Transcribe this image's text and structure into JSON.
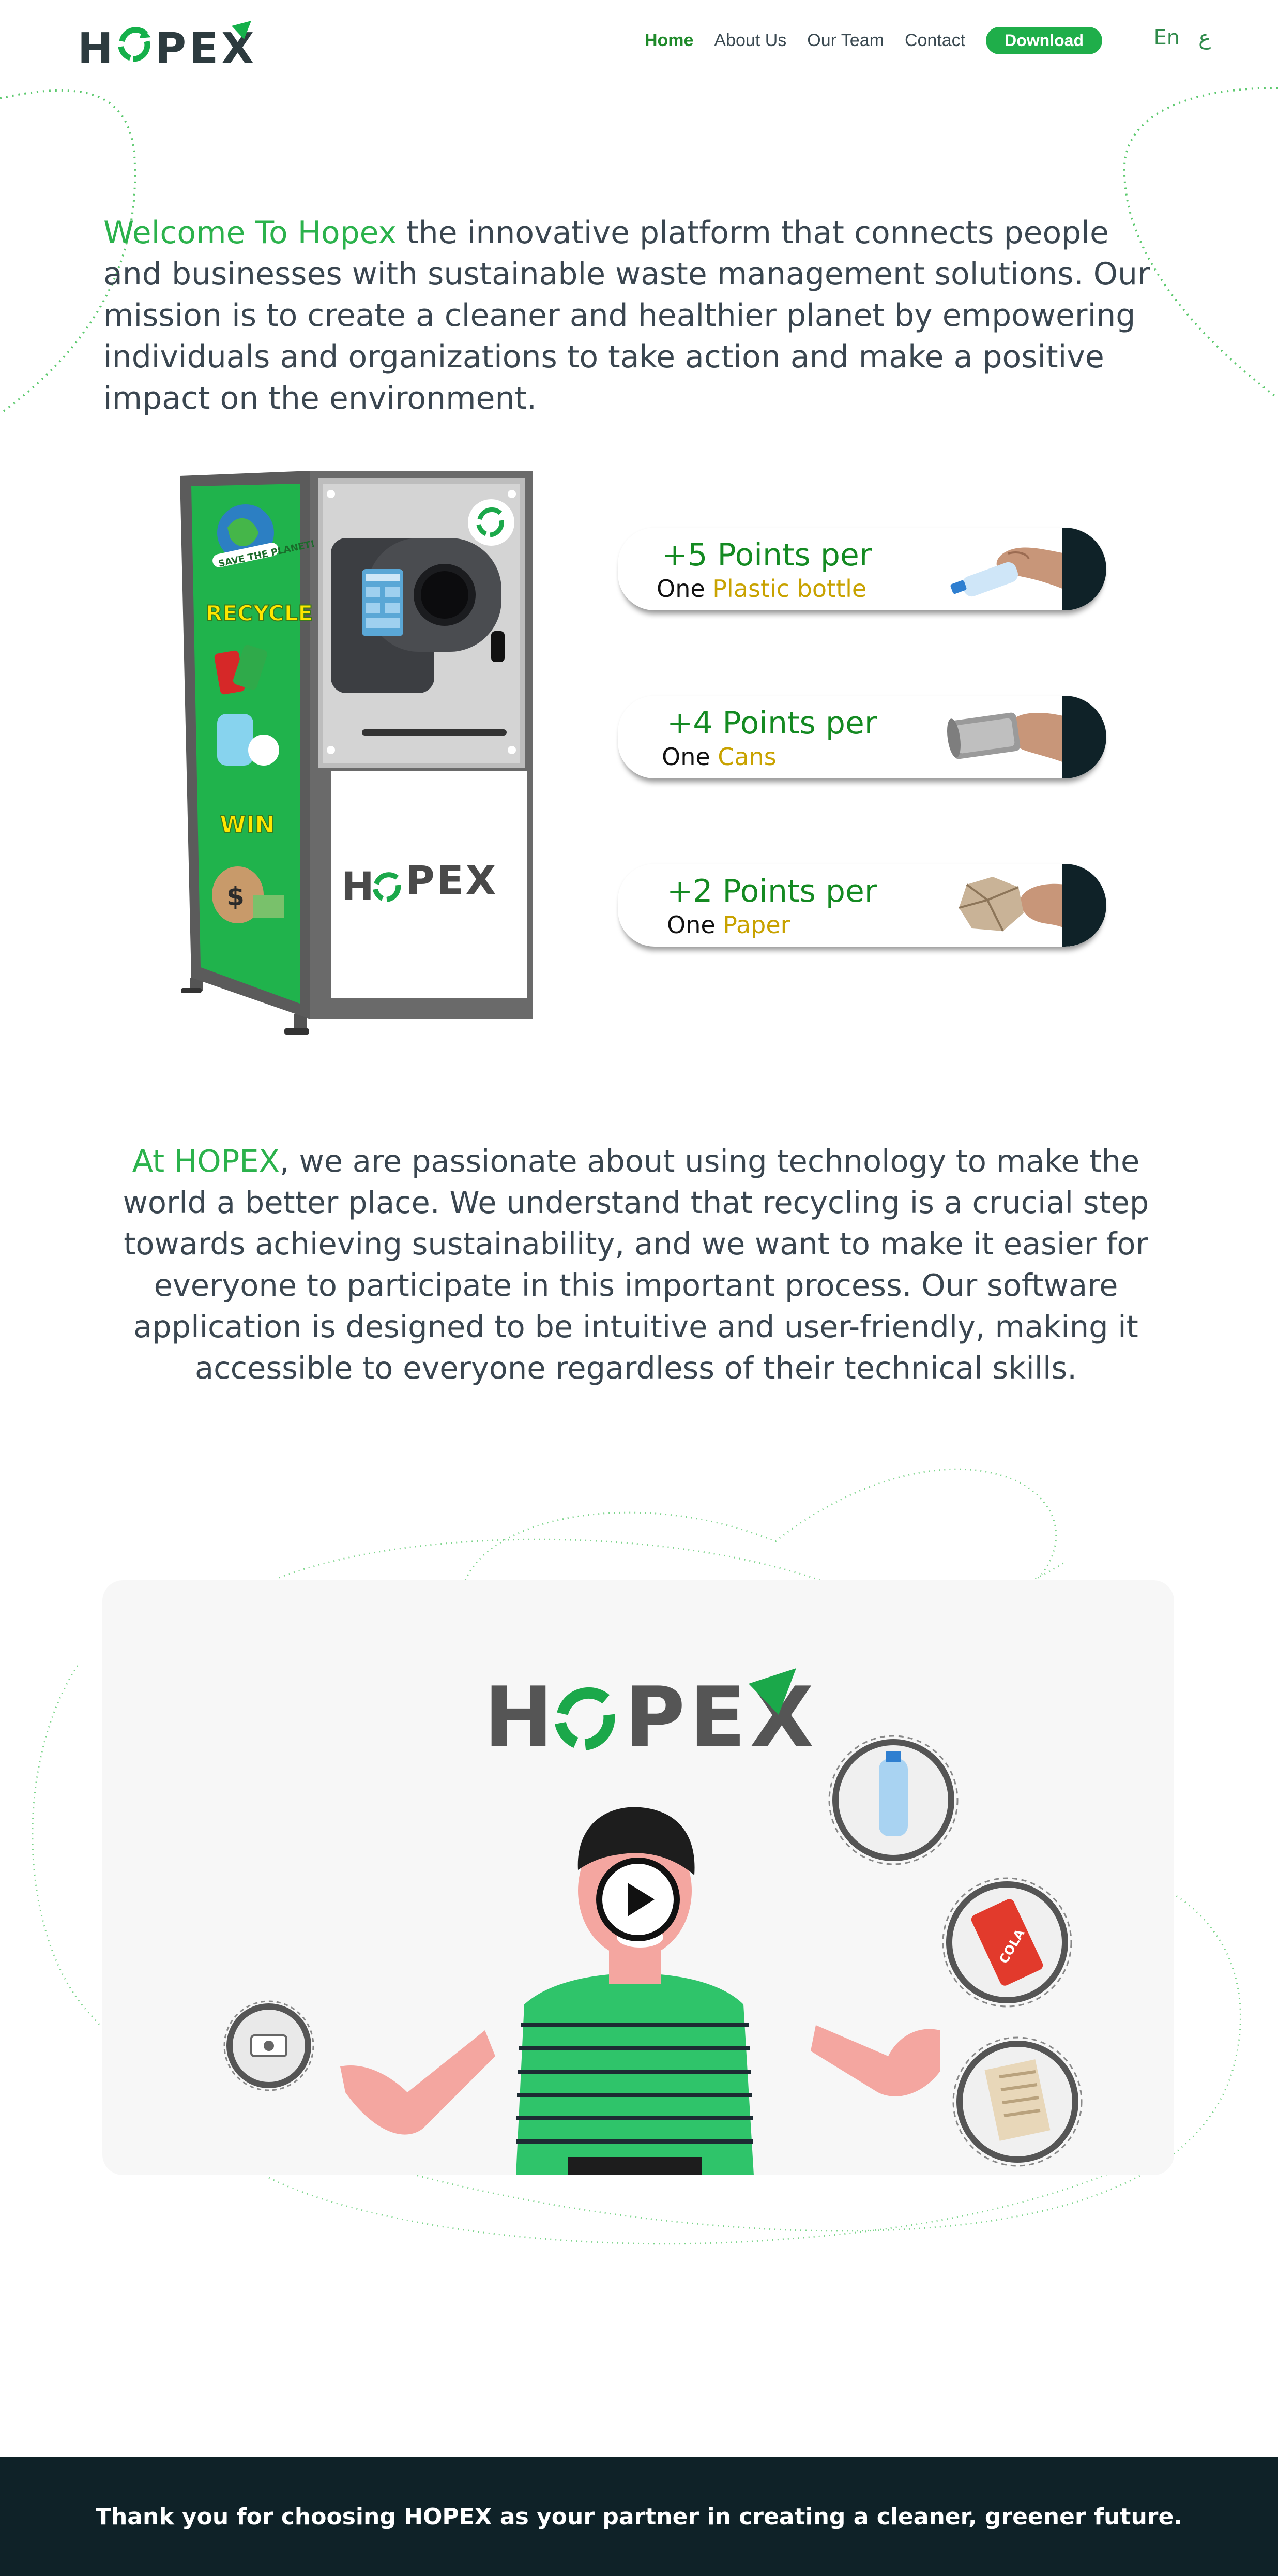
{
  "brand": {
    "logo_text": "HOPEX",
    "primary_color": "#1fae4a",
    "dark_color": "#0f2228",
    "accent_color": "#c8a200"
  },
  "nav": {
    "items": [
      {
        "label": "Home",
        "active": true
      },
      {
        "label": "About Us",
        "active": false
      },
      {
        "label": "Our Team",
        "active": false
      },
      {
        "label": "Contact",
        "active": false
      }
    ],
    "download_label": "Download"
  },
  "language": {
    "en": "En",
    "ar": "ع"
  },
  "intro": {
    "highlight": "Welcome To Hopex",
    "text": " the innovative platform that connects people and businesses with sustainable waste management solutions. Our mission is to create a cleaner and healthier planet by empowering individuals and organizations to take action and make a positive impact on the environment."
  },
  "machine": {
    "side_panel_top": "SAVE THE PLANET!",
    "side_panel_mid": "RECYCLE",
    "side_panel_bottom": "WIN",
    "front_logo": "HOPEX",
    "icons": [
      "recycle-icon",
      "globe-icon",
      "cans-icon",
      "bottle-icon",
      "money-icon"
    ]
  },
  "points": [
    {
      "points": "+5 Points per",
      "one": "One ",
      "item": "Plastic bottle",
      "icon": "bottle-hand-icon"
    },
    {
      "points": "+4 Points per",
      "one": "One ",
      "item": "Cans",
      "icon": "can-hand-icon"
    },
    {
      "points": "+2 Points per",
      "one": "One ",
      "item": "Paper",
      "icon": "paper-hand-icon"
    }
  ],
  "about": {
    "highlight": "At HOPEX",
    "text": ", we are passionate about using technology to make the world a better place. We understand that recycling is a crucial step towards achieving sustainability, and we want to make it easier for everyone to participate in this important process. Our software application is designed to be intuitive and user-friendly, making it accessible to everyone regardless of their technical skills."
  },
  "video": {
    "logo_text": "HOPEX",
    "can_label": "COLA",
    "icons": [
      "play-icon",
      "bottle-icon",
      "can-icon",
      "paper-icon",
      "coin-icon",
      "person-illustration"
    ]
  },
  "footer": {
    "text": "Thank you for choosing HOPEX as your partner in creating a cleaner, greener future."
  }
}
